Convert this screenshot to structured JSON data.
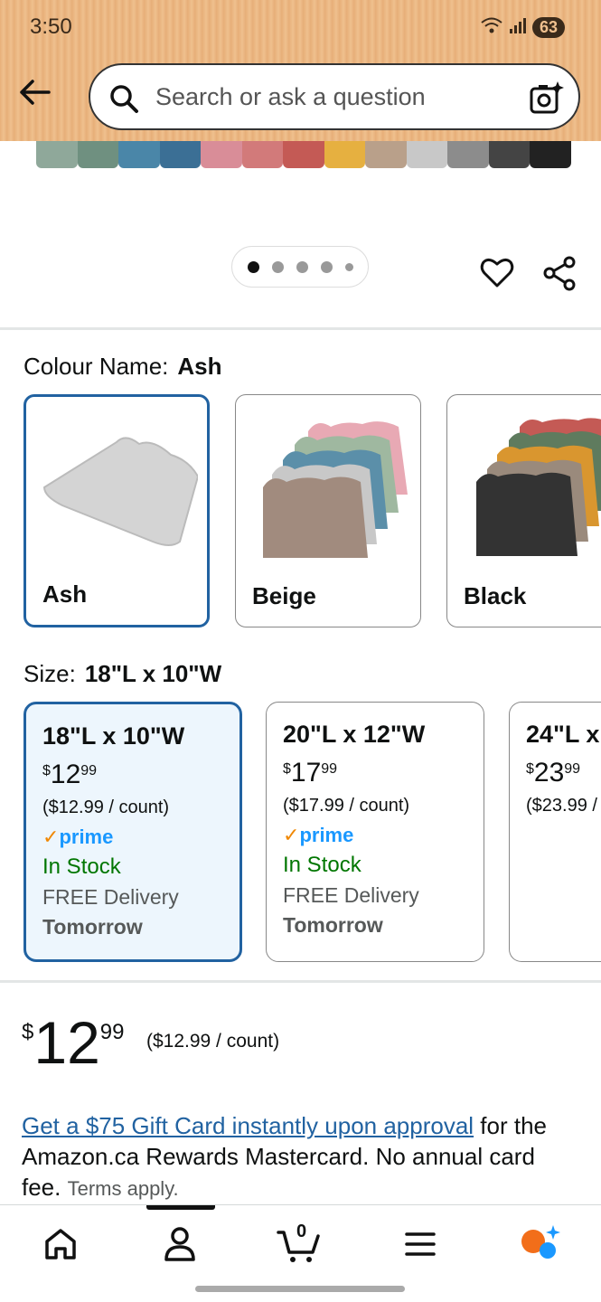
{
  "status_bar": {
    "time": "3:50",
    "battery": "63"
  },
  "search": {
    "placeholder": "Search or ask a question"
  },
  "colour": {
    "label": "Colour Name:",
    "selected": "Ash",
    "options": [
      {
        "label": "Ash"
      },
      {
        "label": "Beige"
      },
      {
        "label": "Black"
      }
    ]
  },
  "size": {
    "label": "Size:",
    "selected": "18\"L x 10\"W",
    "options": [
      {
        "title": "18\"L x 10\"W",
        "currency": "$",
        "whole": "12",
        "fraction": "99",
        "unit": "($12.99 / count)",
        "prime": "prime",
        "stock": "In Stock",
        "delivery": "FREE Delivery",
        "when": "Tomorrow"
      },
      {
        "title": "20\"L x 12\"W",
        "currency": "$",
        "whole": "17",
        "fraction": "99",
        "unit": "($17.99 / count)",
        "prime": "prime",
        "stock": "In Stock",
        "delivery": "FREE Delivery",
        "when": "Tomorrow"
      },
      {
        "title": "24\"L x",
        "currency": "$",
        "whole": "23",
        "fraction": "99",
        "unit": "($23.99 /"
      }
    ]
  },
  "price": {
    "currency": "$",
    "whole": "12",
    "fraction": "99",
    "unit": "($12.99 / count)"
  },
  "promo": {
    "link": "Get a $75 Gift Card instantly upon approval",
    "text": " for the Amazon.ca Rewards Mastercard. No annual card fee. ",
    "terms": "Terms apply."
  },
  "bottom_nav": {
    "cart_count": "0"
  },
  "colors": {
    "accent": "#2162a1",
    "stock_green": "#007600",
    "prime_blue": "#1a98ff"
  }
}
